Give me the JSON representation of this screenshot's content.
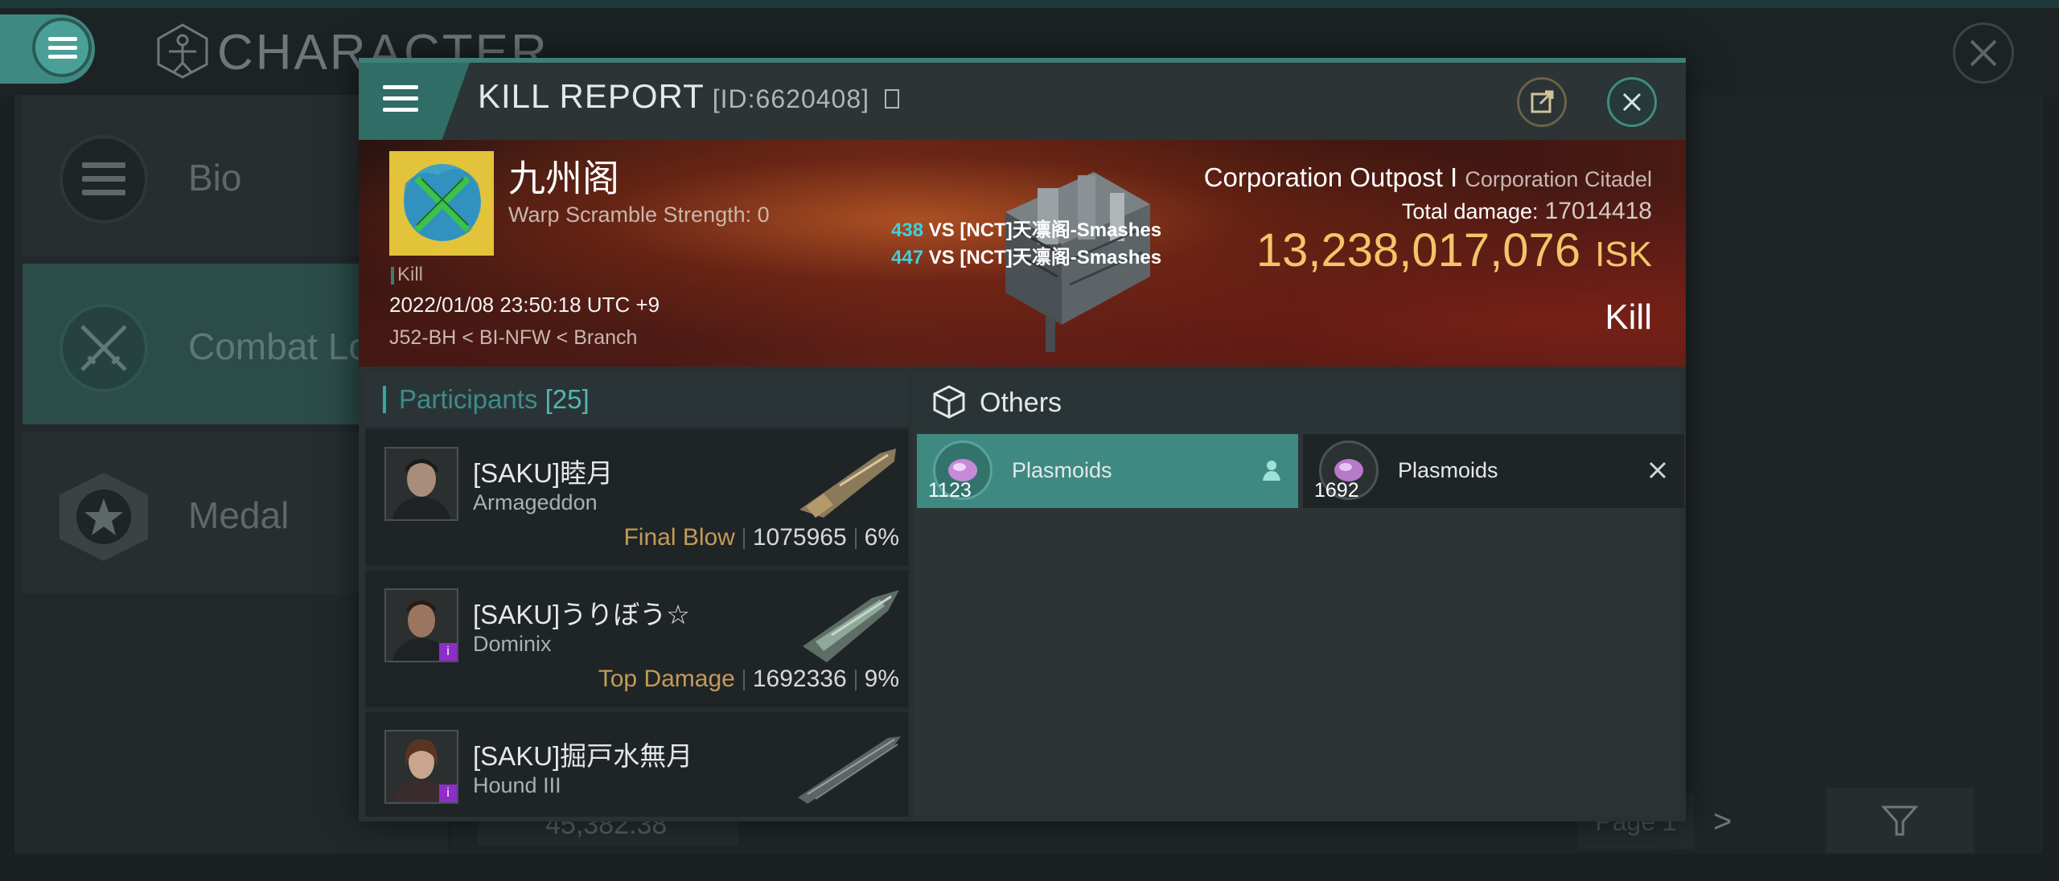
{
  "background": {
    "page_title": "CHARACTER",
    "sidebar": [
      {
        "label": "Bio",
        "icon": "menu-icon"
      },
      {
        "label": "Combat Lo",
        "icon": "crossed-swords-icon"
      },
      {
        "label": "Medal",
        "icon": "star-badge-icon"
      }
    ],
    "amount": "45,382.38",
    "page_label": "Page 1"
  },
  "modal": {
    "title": "KILL REPORT",
    "id": "[ID:6620408]",
    "victim": {
      "corp_name": "九州阁",
      "warp": "Warp Scramble Strength: 0",
      "kill_tag": "Kill",
      "datetime": "2022/01/08 23:50:18 UTC +9",
      "location": "J52-BH < BI-NFW < Branch",
      "type": "Corporation Outpost I",
      "type_sub": "Corporation Citadel",
      "total_damage_label": "Total damage:",
      "total_damage": "17014418",
      "isk_value": "13,238,017,076",
      "isk_unit": "ISK",
      "result": "Kill"
    },
    "versus": [
      {
        "count": "438",
        "text": "VS [NCT]天凛阁-Smashes"
      },
      {
        "count": "447",
        "text": "VS [NCT]天凛阁-Smashes"
      }
    ],
    "participants": {
      "label": "Participants",
      "count": "[25]",
      "rows": [
        {
          "name": "[SAKU]睦月",
          "ship": "Armageddon",
          "tag": "Final Blow",
          "damage": "1075965",
          "percent": "6%"
        },
        {
          "name": "[SAKU]うりぼう☆",
          "ship": "Dominix",
          "tag": "Top Damage",
          "damage": "1692336",
          "percent": "9%"
        },
        {
          "name": "[SAKU]掘戸水無月",
          "ship": "Hound III",
          "tag": "",
          "damage": "",
          "percent": ""
        }
      ]
    },
    "others": {
      "label": "Others",
      "items": [
        {
          "qty": "1123",
          "name": "Plasmoids",
          "icon": "person-icon"
        },
        {
          "qty": "1692",
          "name": "Plasmoids",
          "icon": "close-icon"
        }
      ]
    }
  },
  "colors": {
    "accent": "#3e8a82",
    "isk": "#f3c56a",
    "tag": "#c39b57",
    "versus_count": "#3fd0dc"
  }
}
